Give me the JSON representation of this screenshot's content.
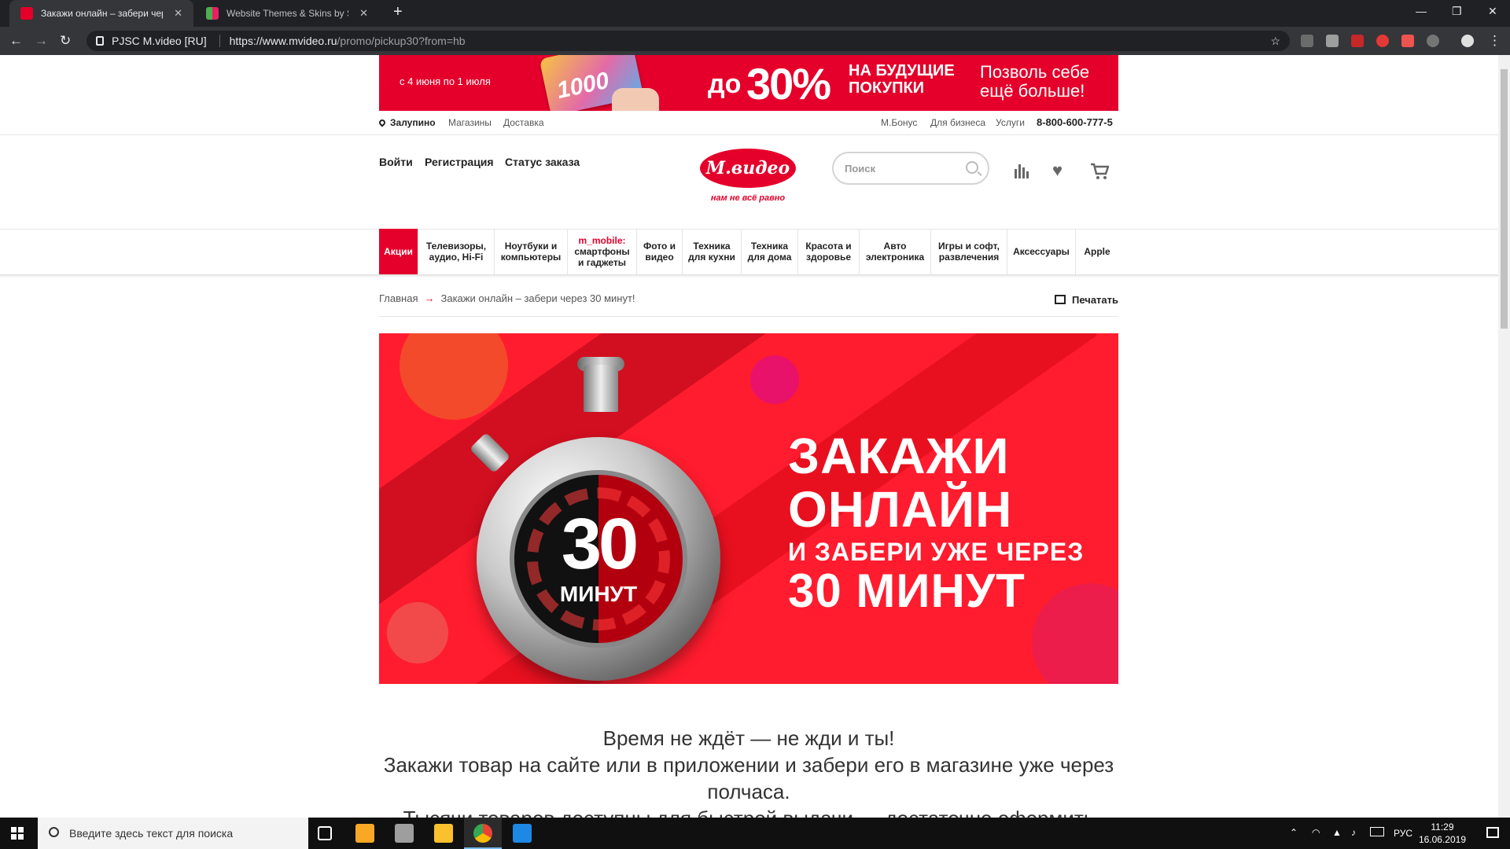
{
  "browser": {
    "tabs": [
      {
        "title": "Закажи онлайн – забери через",
        "active": true
      },
      {
        "title": "Website Themes & Skins by Style",
        "active": false
      }
    ],
    "site_identity": "PJSC M.video [RU]",
    "url_host": "https://www.mvideo.ru",
    "url_path": "/promo/pickup30?from=hb"
  },
  "promo_banner": {
    "dates": "с 4 июня по 1 июля",
    "card_value": "1000",
    "up_to": "до",
    "discount": "30%",
    "future": "НА БУДУЩИЕ ПОКУПКИ",
    "slogan": "Позволь себе ещё больше!"
  },
  "top_strip": {
    "city": "Залупино",
    "stores": "Магазины",
    "delivery": "Доставка",
    "bonus": "М.Бонус",
    "business": "Для бизнеса",
    "services": "Услуги",
    "phone": "8-800-600-777-5"
  },
  "header": {
    "login": "Войти",
    "register": "Регистрация",
    "order_status": "Статус заказа",
    "logo_text": "М.видео",
    "tagline": "нам не всё равно",
    "search_placeholder": "Поиск"
  },
  "categories": [
    {
      "label": "Акции"
    },
    {
      "label": "Телевизоры, аудио, Hi-Fi"
    },
    {
      "label": "Ноутбуки и компьютеры"
    },
    {
      "label_red": "m_mobile:",
      "label": "смартфоны и гаджеты"
    },
    {
      "label": "Фото и видео"
    },
    {
      "label": "Техника для кухни"
    },
    {
      "label": "Техника для дома"
    },
    {
      "label": "Красота и здоровье"
    },
    {
      "label": "Авто электроника"
    },
    {
      "label": "Игры и софт, развлечения"
    },
    {
      "label": "Аксессуары"
    },
    {
      "label": "Apple"
    }
  ],
  "breadcrumbs": {
    "home": "Главная",
    "current": "Закажи онлайн – забери через 30 минут!",
    "print": "Печатать"
  },
  "hero": {
    "timer_number": "30",
    "timer_unit": "МИНУТ",
    "line1": "ЗАКАЖИ",
    "line2": "ОНЛАЙН",
    "line3": "И ЗАБЕРИ УЖЕ ЧЕРЕЗ",
    "line4": "30 МИНУТ"
  },
  "intro": {
    "line1": "Время не ждёт — не жди и ты!",
    "line2": "Закажи товар на сайте или в приложении и забери его в магазине уже через полчаса.",
    "line3": "Тысячи товаров доступны для быстрой выдачи — достаточно оформить"
  },
  "taskbar": {
    "search_placeholder": "Введите здесь текст для поиска",
    "lang": "РУС",
    "time": "11:29",
    "date": "16.06.2019"
  },
  "colors": {
    "brand_red": "#e4002b",
    "hero_red": "#ff1c2e"
  }
}
